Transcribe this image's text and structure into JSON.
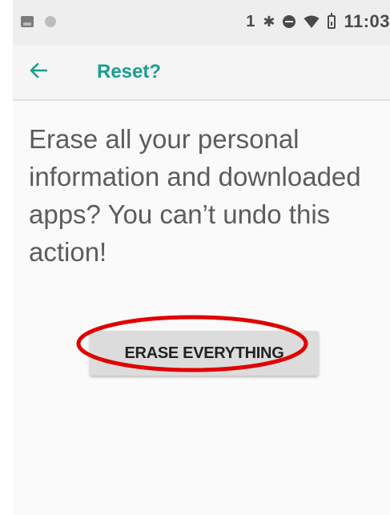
{
  "status_bar": {
    "left_icons": [
      "photo-icon",
      "dot-icon"
    ],
    "sim_label": "1",
    "icons": [
      "bluetooth-icon",
      "do-not-disturb-icon",
      "wifi-icon",
      "battery-icon"
    ],
    "time": "11:03"
  },
  "toolbar": {
    "back_icon": "arrow-left-icon",
    "title": "Reset?"
  },
  "body": {
    "message": "Erase all your personal information and downloaded apps? You can’t undo this action!",
    "erase_button_label": "ERASE EVERYTHING"
  },
  "colors": {
    "accent": "#1a9e8f",
    "highlight_ring": "#e00000",
    "button_bg": "#dcdcdc",
    "message_text": "#5c5c5c"
  }
}
